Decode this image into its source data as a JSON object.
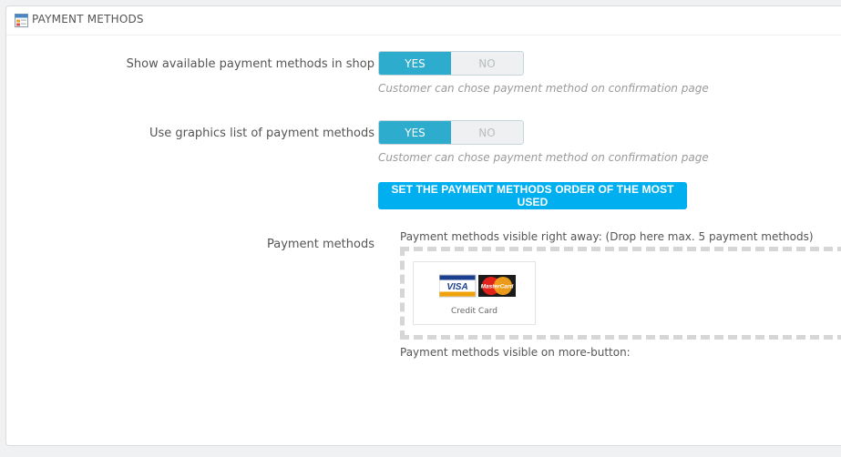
{
  "header": {
    "title": "PAYMENT METHODS",
    "icon": "payment-methods-icon"
  },
  "settings": [
    {
      "label": "Show available payment methods in shop",
      "yes_label": "YES",
      "no_label": "NO",
      "selected": "YES",
      "help": "Customer can chose payment method on confirmation page"
    },
    {
      "label": "Use graphics list of payment methods",
      "yes_label": "YES",
      "no_label": "NO",
      "selected": "YES",
      "help": "Customer can chose payment method on confirmation page"
    }
  ],
  "order_button": {
    "label": "SET THE PAYMENT METHODS ORDER OF THE MOST USED"
  },
  "payment_methods": {
    "label": "Payment methods",
    "visible_heading": "Payment methods visible right away: (Drop here max. 5 payment methods)",
    "more_heading": "Payment methods visible on more-button:",
    "items": [
      {
        "name": "Credit Card",
        "logos": [
          "VISA",
          "MasterCard"
        ]
      }
    ]
  },
  "colors": {
    "accent": "#2eacce",
    "button": "#00aff0",
    "background": "#eff1f2"
  }
}
